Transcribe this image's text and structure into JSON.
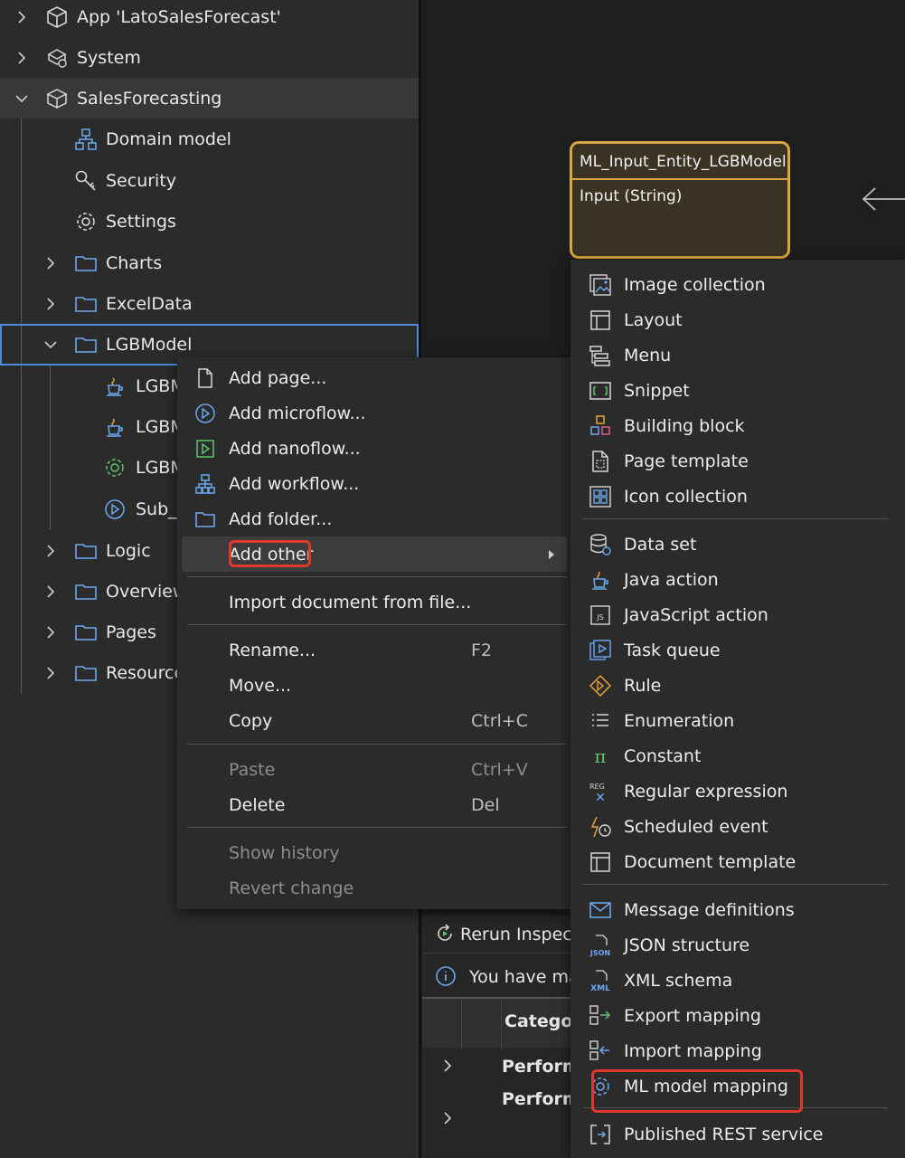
{
  "explorer": {
    "app": "App 'LatoSalesForecast'",
    "system": "System",
    "module": "SalesForecasting",
    "domain_model": "Domain model",
    "security": "Security",
    "settings": "Settings",
    "charts": "Charts",
    "exceldata": "ExcelData",
    "lgbmodel": "LGBModel",
    "child1": "LGBM",
    "child2": "LGBM",
    "child3": "LGBM",
    "child4": "Sub_I",
    "logic": "Logic",
    "overview": "Overview",
    "pages": "Pages",
    "resources": "Resource"
  },
  "entity": {
    "name": "ML_Input_Entity_LGBModel",
    "attribute": "Input (String)"
  },
  "bottom_panel": {
    "rerun": "Rerun Inspecti",
    "message": "You have mac",
    "column_category": "Category",
    "row1": "Perform",
    "row2": "Perform"
  },
  "context_menu": {
    "add_page": "Add page...",
    "add_microflow": "Add microflow...",
    "add_nanoflow": "Add nanoflow...",
    "add_workflow": "Add workflow...",
    "add_folder": "Add folder...",
    "add_other": "Add other",
    "import_document": "Import document from file...",
    "rename": "Rename...",
    "rename_shortcut": "F2",
    "move": "Move...",
    "copy": "Copy",
    "copy_shortcut": "Ctrl+C",
    "paste": "Paste",
    "paste_shortcut": "Ctrl+V",
    "delete": "Delete",
    "delete_shortcut": "Del",
    "show_history": "Show history",
    "revert_change": "Revert change"
  },
  "submenu": {
    "image_collection": "Image collection",
    "layout": "Layout",
    "menu": "Menu",
    "snippet": "Snippet",
    "building_block": "Building block",
    "page_template": "Page template",
    "icon_collection": "Icon collection",
    "data_set": "Data set",
    "java_action": "Java action",
    "javascript_action": "JavaScript action",
    "task_queue": "Task queue",
    "rule": "Rule",
    "enumeration": "Enumeration",
    "constant": "Constant",
    "regular_expression": "Regular expression",
    "scheduled_event": "Scheduled event",
    "document_template": "Document template",
    "message_definitions": "Message definitions",
    "json_structure": "JSON structure",
    "xml_schema": "XML schema",
    "export_mapping": "Export mapping",
    "import_mapping": "Import mapping",
    "ml_model_mapping": "ML model mapping",
    "published_rest_service": "Published REST service"
  },
  "icons": {
    "js_label": "JS",
    "json_label": "JSON",
    "xml_label": "XML",
    "reg_label": "REG",
    "reg_glyph": "✕",
    "pi_glyph": "π"
  },
  "colors": {
    "highlight_red": "#e0392b",
    "selection_blue": "#4a8cdb",
    "entity_border": "#d9a640",
    "icon_blue": "#6aa9f0",
    "icon_green": "#5ec46a",
    "icon_orange": "#e8a23a"
  }
}
